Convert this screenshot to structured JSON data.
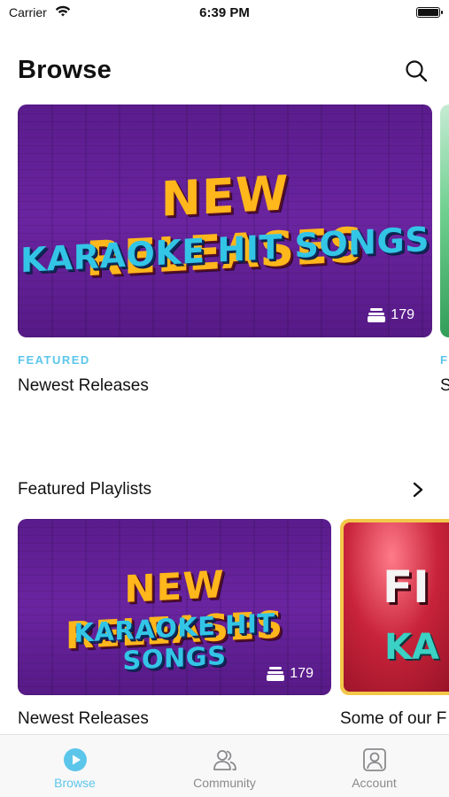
{
  "status_bar": {
    "carrier": "Carrier",
    "time": "6:39 PM"
  },
  "header": {
    "title": "Browse",
    "search_icon": "search-icon"
  },
  "featured": {
    "art_line1": "NEW RELEASES",
    "art_line2": "KARAOKE HIT SONGS",
    "count": "179",
    "label": "FEATURED",
    "name": "Newest Releases",
    "peek_label": "F",
    "peek_name": "S"
  },
  "playlists": {
    "section_title": "Featured Playlists",
    "items": [
      {
        "art_line1": "NEW RELEASES",
        "art_line2": "KARAOKE HIT SONGS",
        "count": "179",
        "name": "Newest Releases"
      },
      {
        "art_line1": "FI",
        "art_line2": "KA",
        "name": "Some of our F"
      }
    ]
  },
  "tabbar": {
    "tabs": [
      {
        "label": "Browse",
        "icon": "play-circle-icon",
        "active": true
      },
      {
        "label": "Community",
        "icon": "people-icon",
        "active": false
      },
      {
        "label": "Account",
        "icon": "person-square-icon",
        "active": false
      }
    ]
  },
  "colors": {
    "accent": "#5cc6ea",
    "banner_purple": "#5a1c8c",
    "art_orange": "#ffb71c",
    "art_cyan": "#33c5e6"
  }
}
